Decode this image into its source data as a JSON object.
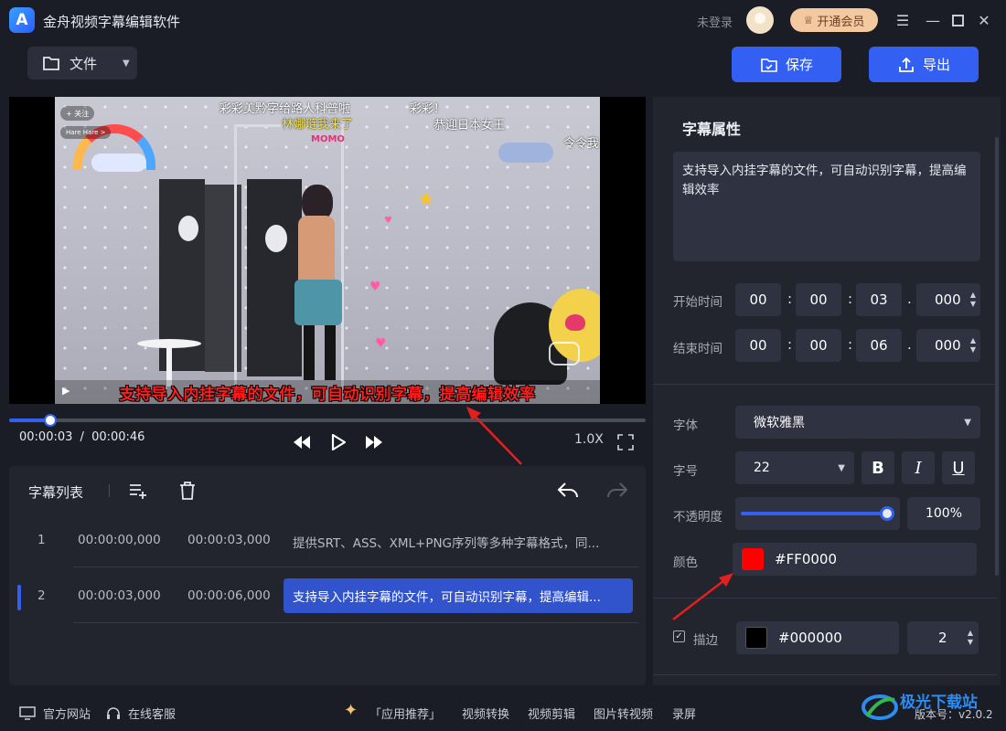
{
  "app": {
    "title": "金舟视频字幕编辑软件",
    "login_text": "未登录",
    "vip_label": "开通会员"
  },
  "toolbar": {
    "file_label": "文件",
    "save_label": "保存",
    "export_label": "导出"
  },
  "video": {
    "overlay_subtitle": "支持导入内挂字幕的文件，可自动识别字幕，提高编辑效率",
    "top_captions": [
      "彩彩美黔字给路人科普啦",
      "彩彩！",
      "林娜琏我来了",
      "恭迎日本女王",
      "MOMO",
      "令令我"
    ],
    "social_tags": [
      "+ 关注",
      "Hare Hare >"
    ],
    "current_time": "00:00:03",
    "time_separator": "/",
    "total_time": "00:00:46",
    "progress_fraction": 0.065,
    "speed": "1.0X"
  },
  "subtitle_list": {
    "title": "字幕列表",
    "rows": [
      {
        "index": "1",
        "start": "00:00:00,000",
        "end": "00:00:03,000",
        "text": "提供SRT、ASS、XML+PNG序列等多种字幕格式，同..."
      },
      {
        "index": "2",
        "start": "00:00:03,000",
        "end": "00:00:06,000",
        "text": "支持导入内挂字幕的文件，可自动识别字幕，提高编辑..."
      }
    ]
  },
  "properties": {
    "title": "字幕属性",
    "text": "支持导入内挂字幕的文件，可自动识别字幕，提高编辑效率",
    "start_label": "开始时间",
    "end_label": "结束时间",
    "start_time": {
      "h": "00",
      "m": "00",
      "s": "03",
      "ms": "000"
    },
    "end_time": {
      "h": "00",
      "m": "00",
      "s": "06",
      "ms": "000"
    },
    "font_label": "字体",
    "font_value": "微软雅黑",
    "size_label": "字号",
    "size_value": "22",
    "bold": "B",
    "italic": "I",
    "underline": "U",
    "opacity_label": "不透明度",
    "opacity_value": "100%",
    "color_label": "颜色",
    "color_value": "#FF0000",
    "stroke_label": "描边",
    "stroke_color": "#000000",
    "stroke_width": "2"
  },
  "footer": {
    "website": "官方网站",
    "service": "在线客服",
    "recommend": "「应用推荐」",
    "links": [
      "视频转换",
      "视频剪辑",
      "图片转视频",
      "录屏"
    ],
    "version_label": "版本号：v2.0.2",
    "watermark": "极光下载站"
  },
  "colors": {
    "accent": "#3360f2",
    "subtitle_red": "#FF0000",
    "selected_row": "#3153cc"
  }
}
